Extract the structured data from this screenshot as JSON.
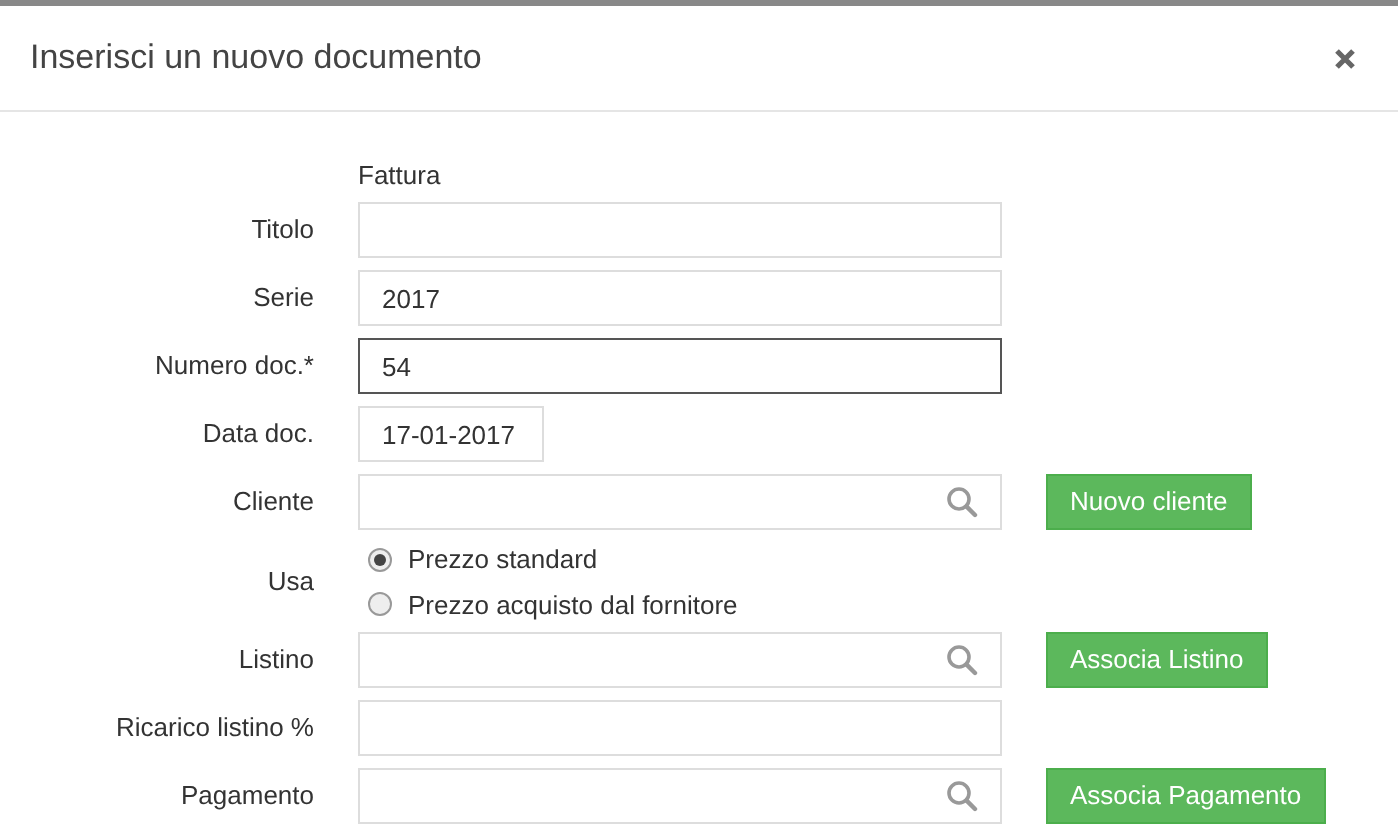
{
  "dialog": {
    "title": "Inserisci un nuovo documento"
  },
  "document_type": "Fattura",
  "rows": [
    {
      "kind": "text",
      "label": "Titolo",
      "value": "",
      "focused": false
    },
    {
      "kind": "text",
      "label": "Serie",
      "value": "2017",
      "focused": false
    },
    {
      "kind": "text",
      "label": "Numero doc.*",
      "value": "54",
      "focused": true
    },
    {
      "kind": "date",
      "label": "Data doc.",
      "value": "17-01-2017",
      "focused": false
    },
    {
      "kind": "search",
      "label": "Cliente",
      "value": "",
      "focused": false,
      "button": "Nuovo cliente"
    },
    {
      "kind": "radio",
      "label": "Usa",
      "options": [
        {
          "label": "Prezzo standard",
          "selected": true
        },
        {
          "label": "Prezzo acquisto dal fornitore",
          "selected": false
        }
      ]
    },
    {
      "kind": "search",
      "label": "Listino",
      "value": "",
      "focused": false,
      "button": "Associa Listino"
    },
    {
      "kind": "text",
      "label": "Ricarico listino %",
      "value": "",
      "focused": false
    },
    {
      "kind": "search",
      "label": "Pagamento",
      "value": "",
      "focused": false,
      "button": "Associa Pagamento"
    }
  ]
}
